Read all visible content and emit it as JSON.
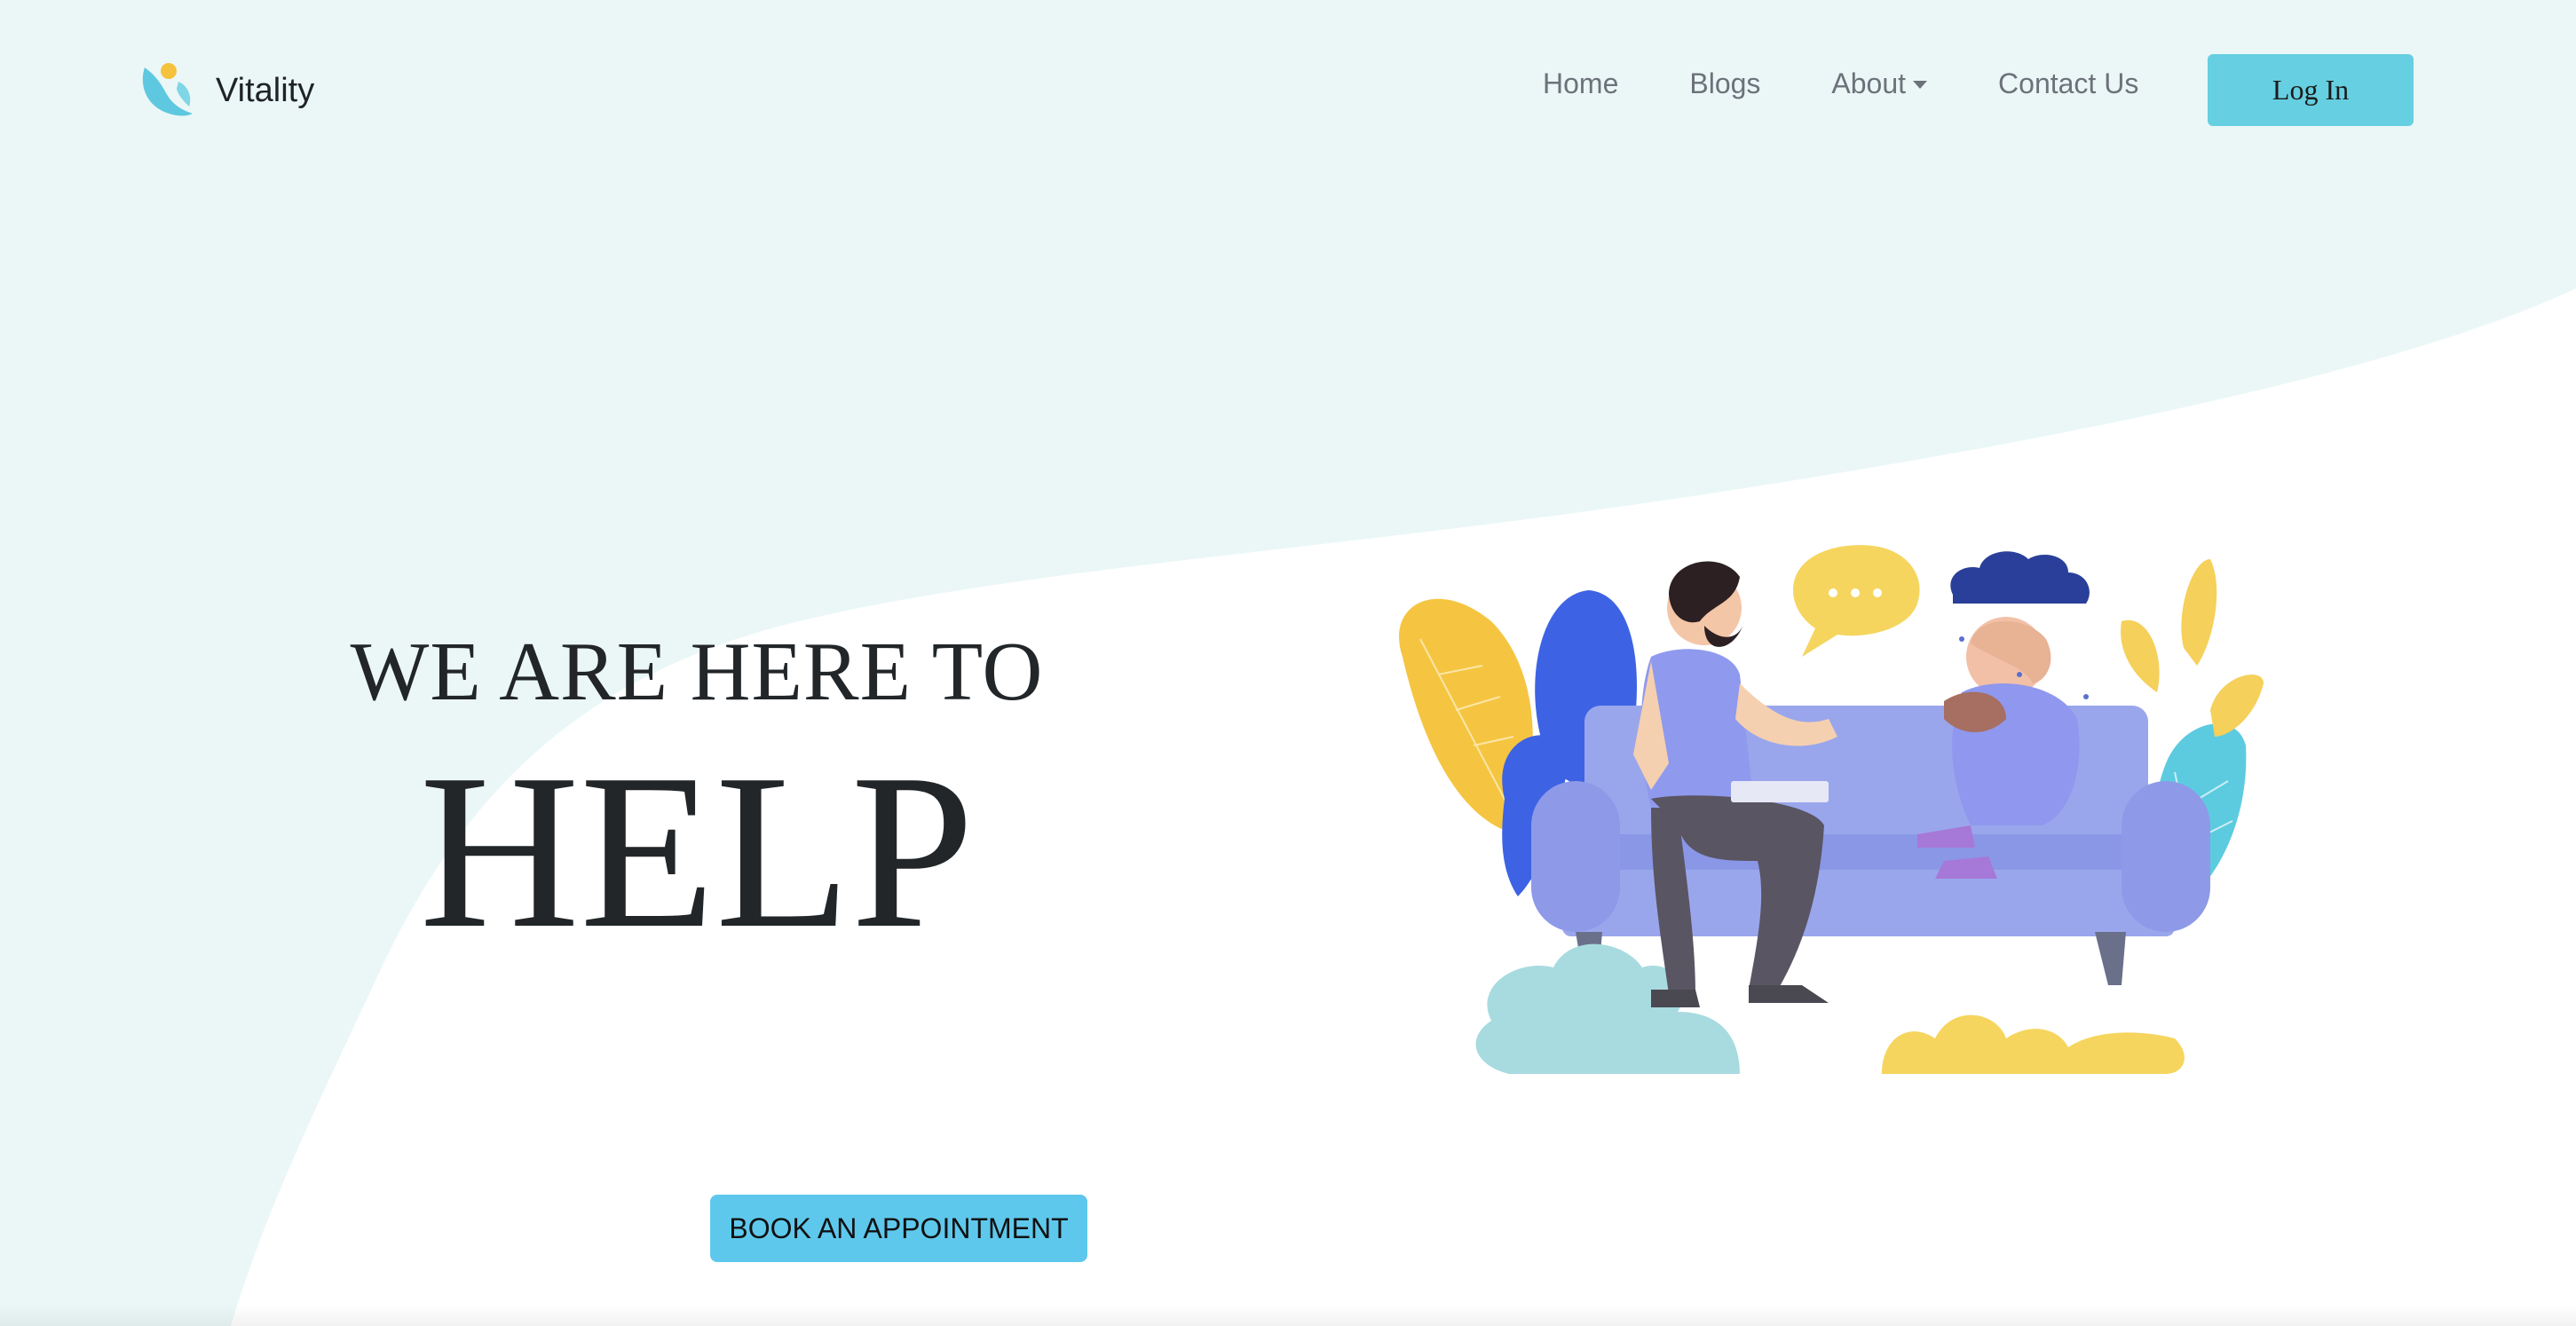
{
  "brand": {
    "name": "Vitality",
    "logo_icon": "vitality-logo-icon"
  },
  "nav": {
    "items": [
      {
        "label": "Home"
      },
      {
        "label": "Blogs"
      },
      {
        "label": "About",
        "has_dropdown": true
      },
      {
        "label": "Contact Us"
      }
    ],
    "login_label": "Log In"
  },
  "hero": {
    "line1": "WE ARE HERE TO",
    "line2": "HELP",
    "cta_label": "BOOK AN APPOINTMENT"
  },
  "illustration": {
    "name": "therapy-session-illustration"
  },
  "colors": {
    "wave_bg": "#ebf7f7",
    "accent_button": "#66cfe1",
    "cta_button": "#5ec8ec",
    "heading_text": "#222629",
    "nav_text": "#6c727a"
  }
}
